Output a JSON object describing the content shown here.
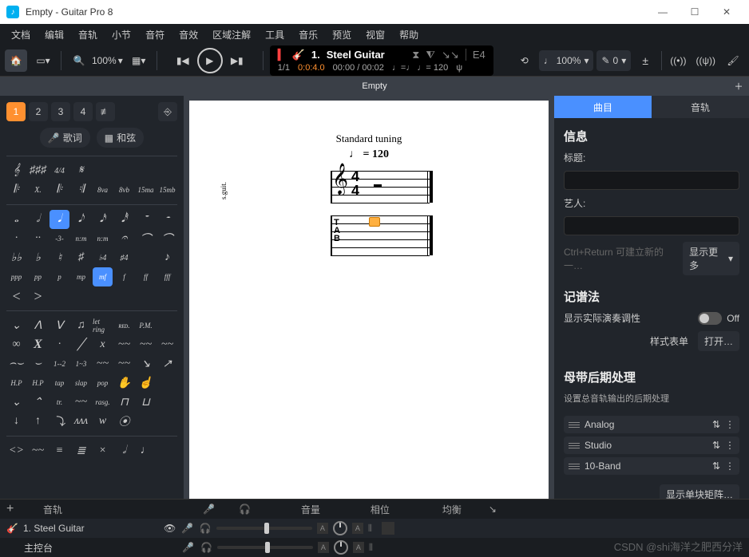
{
  "window": {
    "title": "Empty - Guitar Pro 8"
  },
  "menu": [
    "文档",
    "编辑",
    "音轨",
    "小节",
    "音符",
    "音效",
    "区域注解",
    "工具",
    "音乐",
    "预览",
    "视窗",
    "帮助"
  ],
  "toolbar": {
    "zoom": "100%"
  },
  "transport": {
    "track_no": "1.",
    "track_name": "Steel Guitar",
    "bar": "1/1",
    "beat": "0:0:4.0",
    "time": "00:00 / 00:02",
    "tempo_sig": "♩=♩ ♩= 120",
    "key": "E4"
  },
  "right_tools": {
    "note_pct": "100%",
    "pen": "0"
  },
  "doc_tab": "Empty",
  "palette": {
    "voices": [
      "1",
      "2",
      "3",
      "4"
    ],
    "lyrics": "歌词",
    "chords": "和弦",
    "row_key": [
      "𝄞",
      "♯♯♯",
      "4/4",
      "𝄋",
      "",
      "",
      "",
      ""
    ],
    "row_rep": [
      "𝄆",
      "X.",
      "𝄆",
      "𝄇",
      "8va",
      "8vb",
      "15ma",
      "15mb"
    ],
    "row_dur": [
      "𝅝",
      "𝅗𝅥",
      "𝅘𝅥",
      "𝅘𝅥𝅮",
      "𝅘𝅥𝅯",
      "𝅘𝅥𝅰",
      "𝄻",
      "𝄼"
    ],
    "row_tup": [
      "·",
      "··",
      "-3-",
      "n:m",
      "n:m",
      "𝄐",
      "⌒",
      "⌒"
    ],
    "row_acc": [
      "♭♭",
      "♭",
      "♮",
      "♯",
      "♭4",
      "♯4",
      "",
      "♪"
    ],
    "row_dyn": [
      "ppp",
      "pp",
      "p",
      "mp",
      "mf",
      "f",
      "ff",
      "fff"
    ],
    "row_hair": [
      "<",
      ">",
      "",
      "",
      "",
      "",
      "",
      ""
    ],
    "row_art1": [
      "⌄",
      "ᐱ",
      "ᐯ",
      "♫",
      "let ring",
      "ʀᴇᴅ.",
      "P.M.",
      ""
    ],
    "row_art2": [
      "∞",
      "X",
      "·",
      "╱",
      "x",
      "~~",
      "~~",
      "~~"
    ],
    "row_art3": [
      "⌢⌣",
      "⌣",
      "1--2",
      "1~3",
      "~~",
      "~~",
      "↘",
      "↗"
    ],
    "row_tech": [
      "H.P",
      "H.P",
      "tap",
      "slap",
      "pop",
      "✋",
      "☝",
      ""
    ],
    "row_trem": [
      "⌄",
      "⌃",
      "tr.",
      "~~",
      "rasg.",
      "⊓",
      "⊔",
      ""
    ],
    "row_stroke": [
      "↓",
      "↑",
      "⤵",
      "ᴧᴧᴧ",
      "w",
      "⦿",
      "",
      ""
    ],
    "row_final": [
      "<>",
      "~~",
      "≡",
      "≣",
      "×",
      "𝅗𝅥",
      "♩",
      ""
    ]
  },
  "score": {
    "tuning": "Standard tuning",
    "tempo": "♩ = 120",
    "timesig_top": "4",
    "timesig_bot": "4",
    "tab_letters": [
      "T",
      "A",
      "B"
    ],
    "side_label": "s.guit."
  },
  "right": {
    "tabs": [
      "曲目",
      "音轨"
    ],
    "info_title": "信息",
    "label_title": "标题:",
    "label_artist": "艺人:",
    "hint": "Ctrl+Return 可建立新的一…",
    "show_more": "显示更多",
    "notation_title": "记谱法",
    "show_tuning": "显示实际演奏调性",
    "toggle_off": "Off",
    "stylesheet": "样式表单",
    "open": "打开…",
    "mastering_title": "母带后期处理",
    "mastering_sub": "设置总音轨输出的后期处理",
    "fx": [
      "Analog",
      "Studio",
      "10-Band"
    ],
    "show_matrix": "显示单块矩阵…"
  },
  "bottom": {
    "add": "+",
    "col_track": "音轨",
    "col_vol": "音量",
    "col_pan": "相位",
    "col_eq": "均衡",
    "tracks": [
      {
        "num": "1.",
        "name": "Steel Guitar"
      }
    ],
    "master": "主控台"
  },
  "watermark": "CSDN @shi海洋之肥西分洋"
}
